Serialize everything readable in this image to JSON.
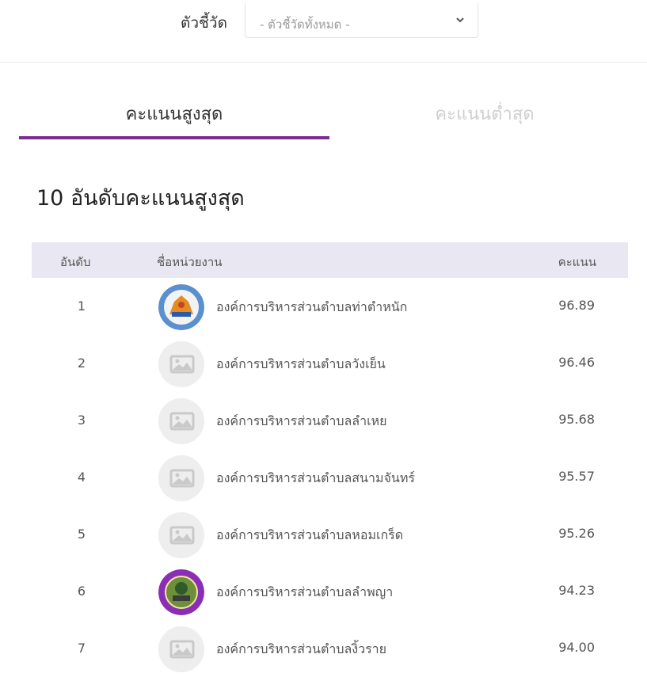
{
  "filter": {
    "label": "ตัวชี้วัด",
    "selected": "- ตัวชี้วัดทั้งหมด -"
  },
  "tabs": [
    {
      "label": "คะแนนสูงสุด",
      "active": true
    },
    {
      "label": "คะแนนต่ำสุด",
      "active": false
    }
  ],
  "heading": "10 อันดับคะแนนสูงสุด",
  "table": {
    "headers": {
      "rank": "อันดับ",
      "name": "ชื่อหน่วยงาน",
      "score": "คะแนน"
    },
    "rows": [
      {
        "rank": "1",
        "name": "องค์การบริหารส่วนตำบลท่าตำหนัก",
        "score": "96.89",
        "logo": "seal-orange-blue"
      },
      {
        "rank": "2",
        "name": "องค์การบริหารส่วนตำบลวังเย็น",
        "score": "96.46",
        "logo": "image-placeholder-icon"
      },
      {
        "rank": "3",
        "name": "องค์การบริหารส่วนตำบลลำเหย",
        "score": "95.68",
        "logo": "image-placeholder-icon"
      },
      {
        "rank": "4",
        "name": "องค์การบริหารส่วนตำบลสนามจันทร์",
        "score": "95.57",
        "logo": "image-placeholder-icon"
      },
      {
        "rank": "5",
        "name": "องค์การบริหารส่วนตำบลหอมเกร็ด",
        "score": "95.26",
        "logo": "image-placeholder-icon"
      },
      {
        "rank": "6",
        "name": "องค์การบริหารส่วนตำบลลำพญา",
        "score": "94.23",
        "logo": "seal-purple-green"
      },
      {
        "rank": "7",
        "name": "องค์การบริหารส่วนตำบลงิ้วราย",
        "score": "94.00",
        "logo": "image-placeholder-icon"
      }
    ]
  },
  "colors": {
    "accent": "#7b2d8e",
    "header_bg": "#e9e8f2"
  }
}
